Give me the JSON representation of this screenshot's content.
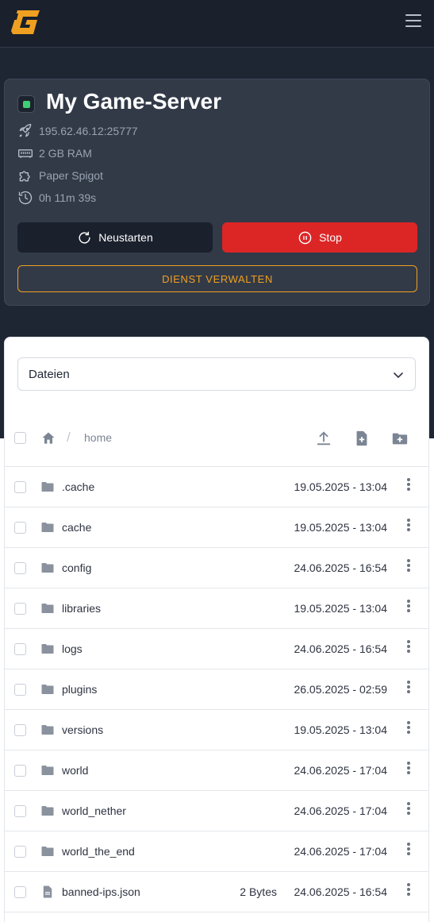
{
  "header": {
    "logo_icon": "g-logo-icon",
    "menu_icon": "hamburger-menu-icon"
  },
  "server": {
    "title": "My Game-Server",
    "status_color": "#3fcf73",
    "address": "195.62.46.12:25777",
    "ram": "2 GB RAM",
    "software": "Paper Spigot",
    "uptime": "0h 11m 39s",
    "restart_label": "Neustarten",
    "stop_label": "Stop",
    "manage_label": "DIENST VERWALTEN"
  },
  "files": {
    "view_select": "Dateien",
    "breadcrumb_home": "home",
    "rows": [
      {
        "name": ".cache",
        "type": "folder",
        "size": "",
        "date": "19.05.2025 - 13:04"
      },
      {
        "name": "cache",
        "type": "folder",
        "size": "",
        "date": "19.05.2025 - 13:04"
      },
      {
        "name": "config",
        "type": "folder",
        "size": "",
        "date": "24.06.2025 - 16:54"
      },
      {
        "name": "libraries",
        "type": "folder",
        "size": "",
        "date": "19.05.2025 - 13:04"
      },
      {
        "name": "logs",
        "type": "folder",
        "size": "",
        "date": "24.06.2025 - 16:54"
      },
      {
        "name": "plugins",
        "type": "folder",
        "size": "",
        "date": "26.05.2025 - 02:59"
      },
      {
        "name": "versions",
        "type": "folder",
        "size": "",
        "date": "19.05.2025 - 13:04"
      },
      {
        "name": "world",
        "type": "folder",
        "size": "",
        "date": "24.06.2025 - 17:04"
      },
      {
        "name": "world_nether",
        "type": "folder",
        "size": "",
        "date": "24.06.2025 - 17:04"
      },
      {
        "name": "world_the_end",
        "type": "folder",
        "size": "",
        "date": "24.06.2025 - 17:04"
      },
      {
        "name": "banned-ips.json",
        "type": "file",
        "size": "2 Bytes",
        "date": "24.06.2025 - 16:54"
      }
    ]
  },
  "colors": {
    "accent": "#f0a020",
    "stop": "#dc2626",
    "dark": "#1a202c"
  }
}
